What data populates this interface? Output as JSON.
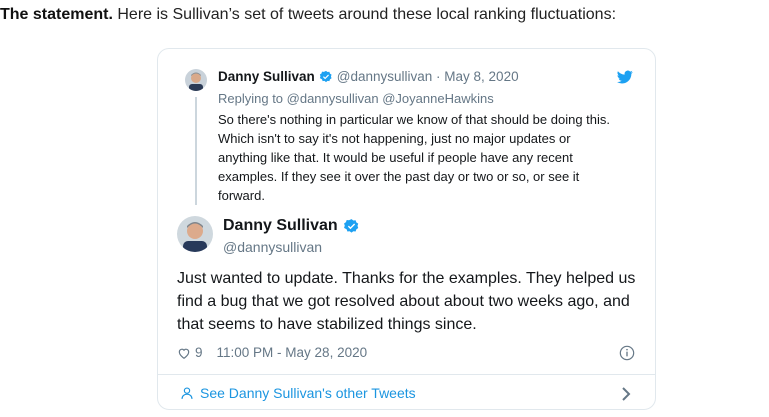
{
  "intro": {
    "bold": "The statement.",
    "text": " Here is Sullivan’s set of tweets around these local ranking fluctuations:"
  },
  "quoted": {
    "name": "Danny Sullivan",
    "meta": "@dannysullivan · May 8, 2020",
    "reply": "Replying to @dannysullivan @JoyanneHawkins",
    "text": "So there's nothing in particular we know of that should be doing this. Which isn't to say it's not happening, just no major updates or anything like that. It would be useful if people have any recent examples. If they see it over the past day or two or so, or see it forward."
  },
  "tweet": {
    "name": "Danny Sullivan",
    "handle": "@dannysullivan",
    "text": "Just wanted to update. Thanks for the examples. They helped us find a bug that we got resolved about about two weeks ago, and that seems to have stabilized things since.",
    "likes": "9",
    "time": "11:00 PM - May 28, 2020"
  },
  "footer": {
    "more": "See Danny Sullivan's other Tweets"
  },
  "icons": {
    "verified": "verified-badge-icon",
    "twitter": "twitter-bird-icon",
    "heart": "heart-icon",
    "info": "info-icon",
    "person": "person-icon",
    "chevron": "chevron-right-icon"
  },
  "colors": {
    "accent": "#1da1f2",
    "link": "#1b95e0",
    "secondary_text": "#657786"
  }
}
